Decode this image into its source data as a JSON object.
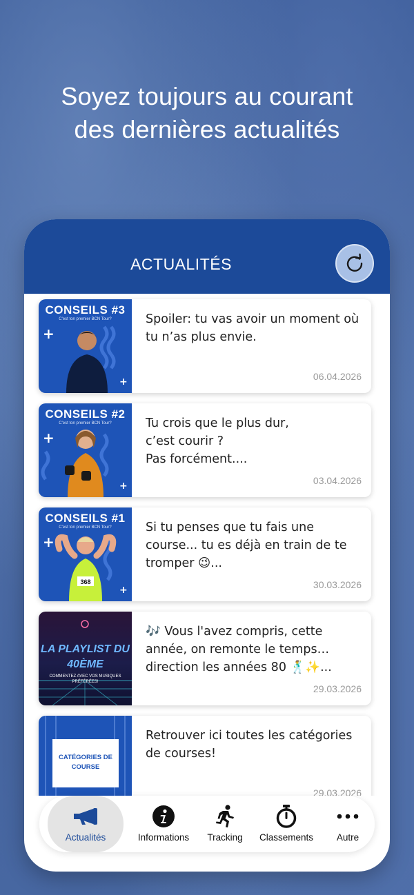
{
  "headline": {
    "line1": "Soyez toujours au courant",
    "line2": "des dernières actualités"
  },
  "header": {
    "title": "ACTUALITÉS",
    "refresh_icon": "refresh-icon"
  },
  "news": [
    {
      "thumb_title": "CONSEILS #3",
      "thumb_subtitle": "C'est ton premier BCN Tour?",
      "text": "Spoiler: tu vas avoir un moment où tu n’as plus envie.",
      "date": "06.04.2026"
    },
    {
      "thumb_title": "CONSEILS #2",
      "thumb_subtitle": "C'est ton premier BCN Tour?",
      "text": "Tu crois que le plus dur,\nc’est courir ?\nPas forcément....",
      "date": "03.04.2026"
    },
    {
      "thumb_title": "CONSEILS #1",
      "thumb_subtitle": "C'est ton premier BCN Tour?",
      "text": "Si tu penses que tu fais une course... tu es déjà en train de te tromper 😉...",
      "date": "30.03.2026"
    },
    {
      "thumb_title": "LA PLAYLIST DU 40ÈME",
      "thumb_subtitle": "COMMENTEZ AVEC VOS MUSIQUES PRÉFÉRÉES!",
      "text": "🎶 Vous l'avez compris, cette année, on remonte le temps… direction les années 80 🕺✨...",
      "date": "29.03.2026"
    },
    {
      "thumb_title": "CATÉGORIES DE COURSE",
      "thumb_subtitle": "",
      "text": "Retrouver ici toutes les catégories de courses!",
      "date": "29.03.2026"
    }
  ],
  "tabs": [
    {
      "label": "Actualités",
      "icon": "megaphone-icon",
      "active": true
    },
    {
      "label": "Informations",
      "icon": "info-icon",
      "active": false
    },
    {
      "label": "Tracking",
      "icon": "runner-icon",
      "active": false
    },
    {
      "label": "Classements",
      "icon": "stopwatch-icon",
      "active": false
    },
    {
      "label": "Autre",
      "icon": "more-icon",
      "active": false
    }
  ],
  "colors": {
    "primary": "#1c4a99",
    "background": "#3f62a0",
    "date": "#9a9a9a"
  }
}
